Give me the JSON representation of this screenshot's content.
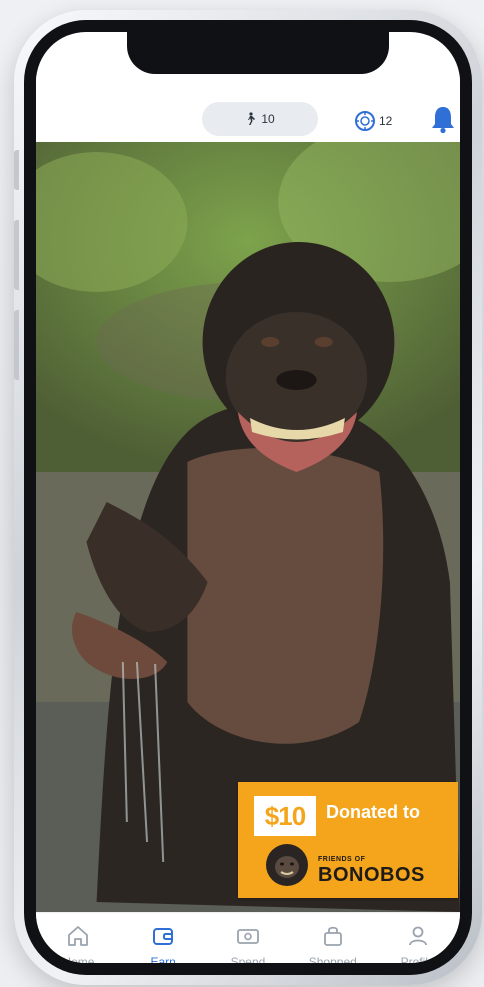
{
  "status": {
    "steps_count": "10",
    "coins_count": "12"
  },
  "promo": {
    "amount": "$10",
    "donated_text": "Donated to",
    "org_line1": "FRIENDS OF",
    "org_line2": "BONOBOS"
  },
  "tabs": [
    {
      "label": "Home",
      "icon": "home-icon",
      "active": false
    },
    {
      "label": "Earn",
      "icon": "wallet-icon",
      "active": true
    },
    {
      "label": "Spend",
      "icon": "cash-icon",
      "active": false
    },
    {
      "label": "Shopped",
      "icon": "bag-icon",
      "active": false
    },
    {
      "label": "Profile",
      "icon": "person-icon",
      "active": false
    }
  ],
  "colors": {
    "accent": "#2f6fd6",
    "badge": "#f4a51c",
    "inactive": "#9aa3ae"
  }
}
